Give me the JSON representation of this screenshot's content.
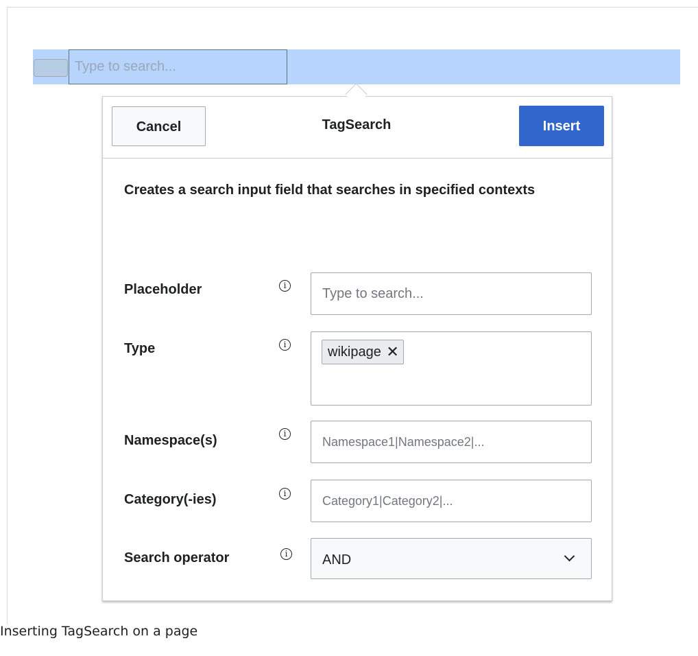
{
  "editor": {
    "preview_placeholder": "Type to search..."
  },
  "dialog": {
    "cancel_label": "Cancel",
    "title": "TagSearch",
    "insert_label": "Insert",
    "description": "Creates a search input field that searches in specified contexts",
    "fields": {
      "placeholder": {
        "label": "Placeholder",
        "placeholder": "Type to search..."
      },
      "type": {
        "label": "Type",
        "tags": [
          "wikipage"
        ],
        "remove_glyph": "✕"
      },
      "namespaces": {
        "label": "Namespace(s)",
        "placeholder": "Namespace1|Namespace2|..."
      },
      "categories": {
        "label": "Category(-ies)",
        "placeholder": "Category1|Category2|..."
      },
      "operator": {
        "label": "Search operator",
        "value": "AND",
        "options": [
          "AND"
        ]
      }
    },
    "info_glyph": "i"
  },
  "caption": "Inserting TagSearch on a page",
  "colors": {
    "highlight": "#b6d4fc",
    "primary": "#3366cc",
    "border": "#a2a9b1",
    "text": "#202122"
  }
}
